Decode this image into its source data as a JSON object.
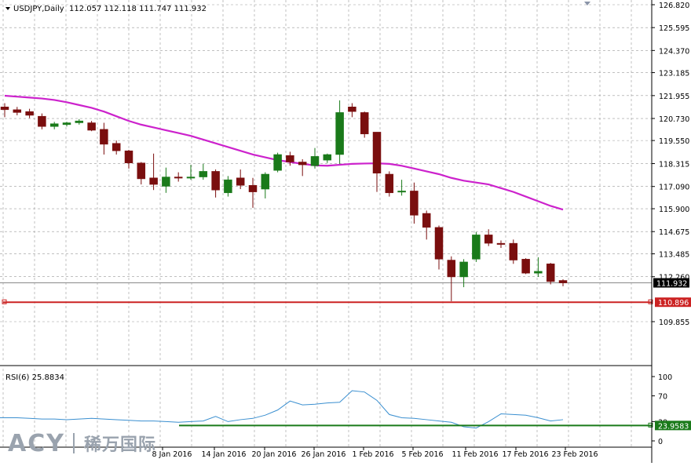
{
  "header": {
    "symbol": "USDJPY,Daily",
    "ohlc": "112.057 112.118 111.747 111.932"
  },
  "rsi_header": "RSI(6) 25.8834",
  "watermark": {
    "mark": "ACY",
    "cn": "稀万国际"
  },
  "colors": {
    "bull": "#1a7a1a",
    "bear": "#7a0e0e",
    "ma": "#cc22cc",
    "rsi": "#3a8fd0",
    "rsi_level": "#1a7a1a",
    "grid": "#9a9a9a",
    "support": "#cc2222"
  },
  "chart_data": [
    {
      "type": "candlestick",
      "title": "USDJPY,Daily",
      "y_ticks": [
        "126.820",
        "125.595",
        "124.370",
        "123.185",
        "121.955",
        "120.730",
        "119.550",
        "118.315",
        "117.090",
        "115.900",
        "114.675",
        "113.485",
        "112.260",
        "109.855"
      ],
      "current_price": 111.932,
      "support_level": 110.896,
      "candles": [
        {
          "o": 121.35,
          "h": 121.55,
          "l": 120.8,
          "c": 121.2
        },
        {
          "o": 121.2,
          "h": 121.35,
          "l": 120.9,
          "c": 121.05
        },
        {
          "o": 121.1,
          "h": 121.25,
          "l": 120.75,
          "c": 120.9
        },
        {
          "o": 120.85,
          "h": 121.0,
          "l": 120.15,
          "c": 120.3
        },
        {
          "o": 120.3,
          "h": 120.55,
          "l": 120.15,
          "c": 120.45
        },
        {
          "o": 120.4,
          "h": 120.55,
          "l": 120.3,
          "c": 120.5
        },
        {
          "o": 120.5,
          "h": 120.7,
          "l": 120.4,
          "c": 120.6
        },
        {
          "o": 120.5,
          "h": 120.6,
          "l": 120.05,
          "c": 120.1
        },
        {
          "o": 120.15,
          "h": 120.5,
          "l": 118.8,
          "c": 119.35
        },
        {
          "o": 119.4,
          "h": 119.55,
          "l": 118.8,
          "c": 119.0
        },
        {
          "o": 119.0,
          "h": 119.05,
          "l": 118.05,
          "c": 118.35
        },
        {
          "o": 118.35,
          "h": 118.4,
          "l": 117.2,
          "c": 117.5
        },
        {
          "o": 117.55,
          "h": 118.85,
          "l": 116.9,
          "c": 117.2
        },
        {
          "o": 117.1,
          "h": 118.1,
          "l": 116.75,
          "c": 117.6
        },
        {
          "o": 117.6,
          "h": 117.85,
          "l": 117.35,
          "c": 117.55
        },
        {
          "o": 117.55,
          "h": 118.25,
          "l": 117.45,
          "c": 117.6
        },
        {
          "o": 117.6,
          "h": 118.3,
          "l": 117.45,
          "c": 117.9
        },
        {
          "o": 117.9,
          "h": 118.0,
          "l": 116.5,
          "c": 116.9
        },
        {
          "o": 116.75,
          "h": 117.65,
          "l": 116.55,
          "c": 117.45
        },
        {
          "o": 117.55,
          "h": 118.0,
          "l": 116.95,
          "c": 117.15
        },
        {
          "o": 117.15,
          "h": 117.55,
          "l": 115.95,
          "c": 116.8
        },
        {
          "o": 116.95,
          "h": 117.85,
          "l": 116.45,
          "c": 117.75
        },
        {
          "o": 117.95,
          "h": 118.9,
          "l": 117.85,
          "c": 118.8
        },
        {
          "o": 118.75,
          "h": 118.95,
          "l": 118.2,
          "c": 118.4
        },
        {
          "o": 118.4,
          "h": 118.55,
          "l": 117.65,
          "c": 118.25
        },
        {
          "o": 118.2,
          "h": 119.15,
          "l": 118.05,
          "c": 118.7
        },
        {
          "o": 118.5,
          "h": 118.85,
          "l": 118.35,
          "c": 118.8
        },
        {
          "o": 118.8,
          "h": 121.7,
          "l": 118.3,
          "c": 121.05
        },
        {
          "o": 121.35,
          "h": 121.55,
          "l": 120.8,
          "c": 121.1
        },
        {
          "o": 121.05,
          "h": 121.1,
          "l": 119.7,
          "c": 119.9
        },
        {
          "o": 120.0,
          "h": 120.0,
          "l": 116.8,
          "c": 117.8
        },
        {
          "o": 117.75,
          "h": 117.9,
          "l": 116.55,
          "c": 116.75
        },
        {
          "o": 116.8,
          "h": 117.45,
          "l": 116.6,
          "c": 116.85
        },
        {
          "o": 116.85,
          "h": 117.3,
          "l": 115.1,
          "c": 115.55
        },
        {
          "o": 115.65,
          "h": 115.8,
          "l": 114.25,
          "c": 114.9
        },
        {
          "o": 114.9,
          "h": 115.0,
          "l": 112.65,
          "c": 113.2
        },
        {
          "o": 113.15,
          "h": 113.35,
          "l": 110.95,
          "c": 112.25
        },
        {
          "o": 112.25,
          "h": 113.2,
          "l": 111.7,
          "c": 113.05
        },
        {
          "o": 113.2,
          "h": 114.65,
          "l": 113.05,
          "c": 114.5
        },
        {
          "o": 114.5,
          "h": 114.8,
          "l": 113.9,
          "c": 114.05
        },
        {
          "o": 114.05,
          "h": 114.2,
          "l": 113.8,
          "c": 114.0
        },
        {
          "o": 114.05,
          "h": 114.25,
          "l": 112.95,
          "c": 113.15
        },
        {
          "o": 113.2,
          "h": 113.25,
          "l": 112.4,
          "c": 112.45
        },
        {
          "o": 112.45,
          "h": 113.3,
          "l": 112.25,
          "c": 112.55
        },
        {
          "o": 112.95,
          "h": 113.0,
          "l": 111.85,
          "c": 112.0
        },
        {
          "o": 112.06,
          "h": 112.12,
          "l": 111.75,
          "c": 111.93
        }
      ],
      "moving_average": [
        121.95,
        121.9,
        121.85,
        121.8,
        121.72,
        121.6,
        121.45,
        121.3,
        121.1,
        120.85,
        120.6,
        120.4,
        120.25,
        120.1,
        119.95,
        119.8,
        119.6,
        119.4,
        119.2,
        119.0,
        118.8,
        118.65,
        118.5,
        118.4,
        118.3,
        118.22,
        118.2,
        118.25,
        118.3,
        118.32,
        118.33,
        118.3,
        118.2,
        118.05,
        117.9,
        117.75,
        117.55,
        117.4,
        117.3,
        117.2,
        117.0,
        116.8,
        116.55,
        116.3,
        116.05,
        115.85
      ]
    },
    {
      "type": "line",
      "title": "RSI(6) 25.8834",
      "y_ticks": [
        "100",
        "70",
        "30",
        "0"
      ],
      "level": 23.9583,
      "x_tick_labels": [
        "8 Jan 2016",
        "14 Jan 2016",
        "20 Jan 2016",
        "26 Jan 2016",
        "1 Feb 2016",
        "5 Feb 2016",
        "11 Feb 2016",
        "17 Feb 2016",
        "23 Feb 2016"
      ],
      "values": [
        36,
        36,
        35,
        34,
        34,
        33,
        34,
        35,
        34,
        33,
        32,
        31,
        31,
        30,
        29,
        30,
        31,
        38,
        30,
        33,
        35,
        40,
        48,
        62,
        56,
        57,
        59,
        60,
        78,
        76,
        63,
        41,
        36,
        35,
        33,
        31,
        29,
        22,
        20,
        30,
        42,
        41,
        40,
        36,
        31,
        33
      ]
    }
  ]
}
